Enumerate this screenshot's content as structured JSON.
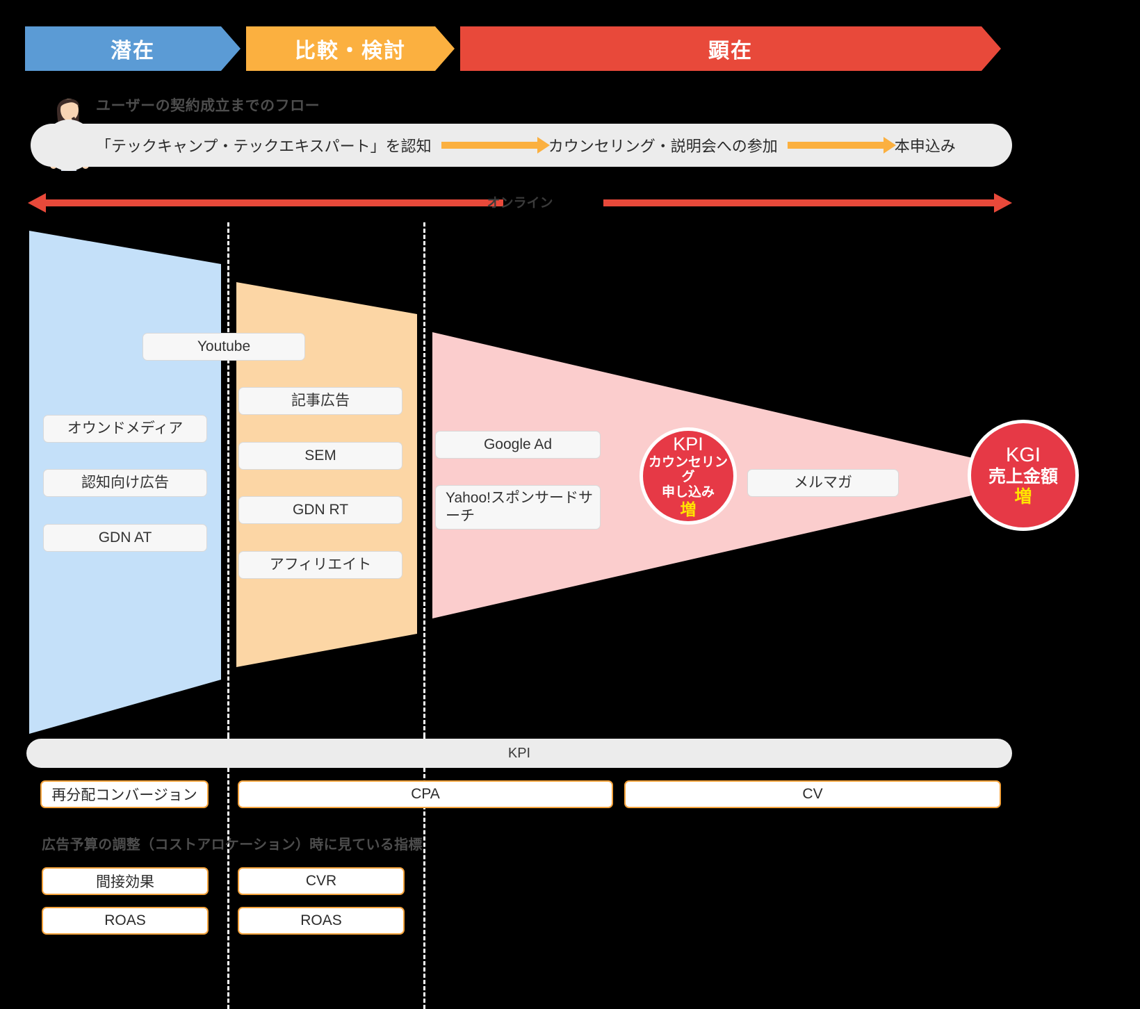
{
  "banner": {
    "stages": [
      {
        "label": "潜在",
        "color": "#5b9bd5"
      },
      {
        "label": "比較・検討",
        "color": "#fbb040"
      },
      {
        "label": "顕在",
        "color": "#e8493a"
      }
    ]
  },
  "flow": {
    "title": "ユーザーの契約成立までのフロー",
    "steps": [
      "「テックキャンプ・テックエキスパート」を認知",
      "カウンセリング・説明会への参加",
      "本申込み"
    ],
    "arrow_color": "#fbb040"
  },
  "online": {
    "label": "オンライン",
    "color": "#e8493a"
  },
  "funnel": {
    "stages": [
      {
        "name": "潜在",
        "fill": "#c4e0f9"
      },
      {
        "name": "比較・検討",
        "fill": "#fcd6a5"
      },
      {
        "name": "顕在",
        "fill": "#fbcdcd"
      }
    ],
    "channels": [
      {
        "label": "Youtube",
        "stage": "潜在/比較・検討"
      },
      {
        "label": "オウンドメディア",
        "stage": "潜在"
      },
      {
        "label": "認知向け広告",
        "stage": "潜在"
      },
      {
        "label": "GDN AT",
        "stage": "潜在"
      },
      {
        "label": "記事広告",
        "stage": "比較・検討"
      },
      {
        "label": "SEM",
        "stage": "比較・検討"
      },
      {
        "label": "GDN RT",
        "stage": "比較・検討"
      },
      {
        "label": "アフィリエイト",
        "stage": "比較・検討"
      },
      {
        "label": "Google Ad",
        "stage": "顕在"
      },
      {
        "label": "Yahoo!スポンサードサーチ",
        "stage": "顕在"
      },
      {
        "label": "メルマガ",
        "stage": "顕在"
      }
    ]
  },
  "kpi_circle": {
    "title": "KPI",
    "line1": "カウンセリング",
    "line2": "申し込み",
    "line3": "増",
    "fill": "#e63946",
    "accent": "#ffe400"
  },
  "kgi_circle": {
    "title": "KGI",
    "line1": "売上金額",
    "line2": "増",
    "fill": "#e63946",
    "accent": "#ffe400"
  },
  "kpi_section": {
    "banner_label": "KPI",
    "metrics": [
      {
        "label": "再分配コンバージョン",
        "stage": "潜在"
      },
      {
        "label": "CPA",
        "stage": "比較・検討"
      },
      {
        "label": "CV",
        "stage": "顕在"
      }
    ]
  },
  "allocation": {
    "note": "広告予算の調整（コストアロケーション）時に見ている指標",
    "rows": [
      {
        "left": "間接効果",
        "middle": "CVR"
      },
      {
        "left": "ROAS",
        "middle": "ROAS"
      }
    ]
  }
}
